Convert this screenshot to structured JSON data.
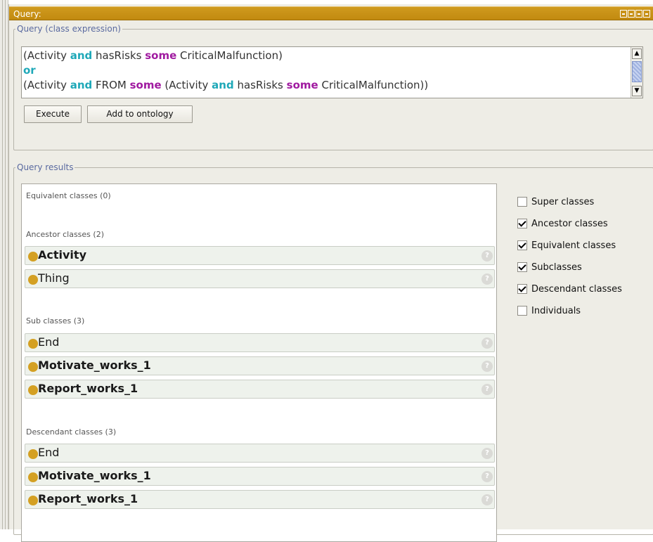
{
  "window": {
    "title": "Query:"
  },
  "query_group": {
    "legend": "Query (class expression)",
    "line1": {
      "p1": "(Activity ",
      "and": "and",
      "p2": " hasRisks ",
      "some": "some",
      "p3": " CriticalMalfunction)"
    },
    "line2": {
      "or": "or"
    },
    "line3": {
      "p1": "(Activity ",
      "and1": "and",
      "p2": " FROM ",
      "some1": "some",
      "p3": " (Activity ",
      "and2": "and",
      "p4": " hasRisks ",
      "some2": "some",
      "p5": " CriticalMalfunction))"
    },
    "buttons": {
      "execute": "Execute",
      "add": "Add to ontology"
    }
  },
  "results_group": {
    "legend": "Query results",
    "sections": {
      "equivalent": "Equivalent classes (0)",
      "ancestor": "Ancestor classes (2)",
      "sub": "Sub classes (3)",
      "descendant": "Descendant classes (3)"
    },
    "ancestor_items": [
      "Activity",
      "Thing"
    ],
    "sub_items": [
      "End",
      "Motivate_works_1",
      "Report_works_1"
    ],
    "descendant_items": [
      "End",
      "Motivate_works_1",
      "Report_works_1"
    ],
    "help_glyph": "?"
  },
  "options": [
    {
      "label": "Super classes",
      "checked": false
    },
    {
      "label": "Ancestor classes",
      "checked": true
    },
    {
      "label": "Equivalent classes",
      "checked": true
    },
    {
      "label": "Subclasses",
      "checked": true
    },
    {
      "label": "Descendant classes",
      "checked": true
    },
    {
      "label": "Individuals",
      "checked": false
    }
  ],
  "colors": {
    "title_bar": "#c8921a",
    "keyword_and_or": "#1ea8b8",
    "keyword_some": "#a01aa0",
    "class_dot": "#d4a023"
  }
}
